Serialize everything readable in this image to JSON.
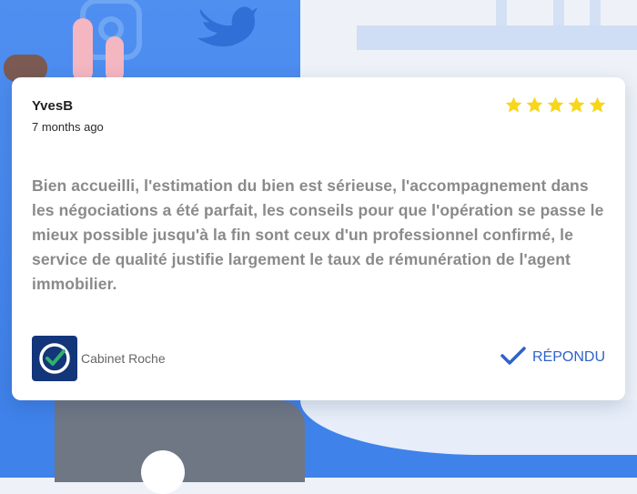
{
  "review": {
    "author": "YvesB",
    "date": "7 months ago",
    "rating": 5,
    "rating_max": 5,
    "text": "Bien accueilli, l'estimation du bien est sérieuse, l'accompagnement dans les négociations a été parfait, les conseils pour que l'opération se passe le mieux possible jusqu'à la fin sont ceux d'un professionnel confirmé, le service de qualité justifie largement le taux de rémunération de l'agent immobilier.",
    "owner_name": "Cabinet Roche",
    "status": "RÉPONDU"
  },
  "colors": {
    "star": "#f7d61b",
    "accent": "#2f62c9",
    "owner_logo_bg": "#13357a",
    "background_blue": "#3d7ee8"
  },
  "icons": {
    "star": "star-icon",
    "check": "check-icon",
    "logo": "cabinet-logo-icon",
    "background": [
      "instagram-icon",
      "twitter-icon"
    ]
  }
}
